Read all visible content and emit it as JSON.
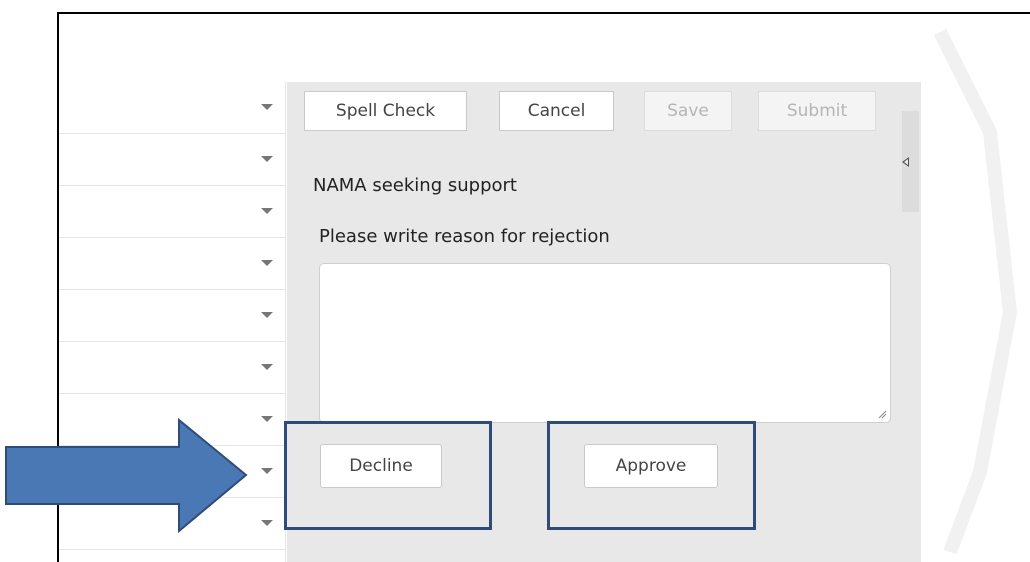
{
  "toolbar": {
    "spell_check": "Spell Check",
    "cancel": "Cancel",
    "save": "Save",
    "submit": "Submit"
  },
  "form": {
    "title": "NAMA seeking support",
    "reason_label": "Please write reason for rejection",
    "reason_value": ""
  },
  "actions": {
    "decline": "Decline",
    "approve": "Approve"
  },
  "list": {
    "rows": 9
  },
  "colors": {
    "panel": "#e8e8e8",
    "highlight_border": "#2f4b7a",
    "arrow_fill": "#4a78b5",
    "arrow_stroke": "#2f4b7a"
  },
  "icons": [
    "chevron-down-icon",
    "collapse-panel-icon",
    "resize-handle-icon",
    "pointer-arrow"
  ]
}
